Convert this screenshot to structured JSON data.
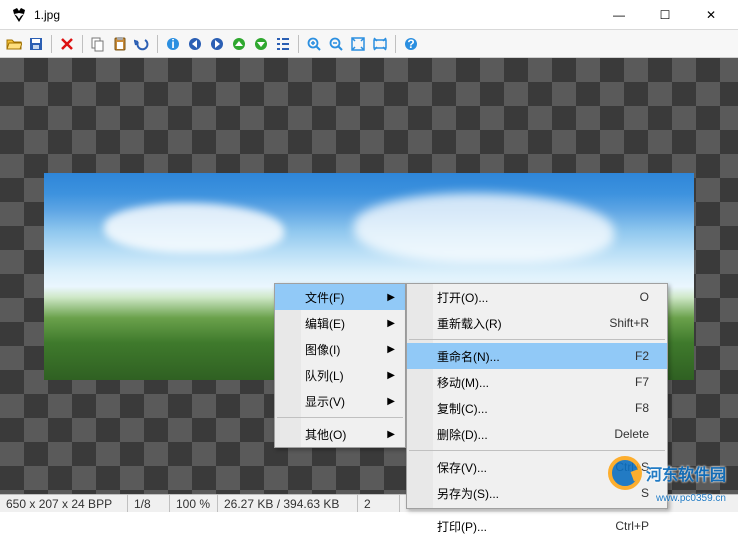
{
  "window": {
    "title": "1.jpg",
    "controls": {
      "min": "—",
      "max": "☐",
      "close": "✕"
    }
  },
  "toolbar": {
    "open": "open",
    "save": "save",
    "delete": "delete",
    "copy": "copy",
    "paste": "paste",
    "undo": "undo",
    "info": "info",
    "prev": "prev",
    "next": "next",
    "rotL": "rotate-left",
    "rotR": "rotate-right",
    "list": "list",
    "zoomIn": "zoom-in",
    "zoomOut": "zoom-out",
    "fit": "fit",
    "orig": "1:1",
    "help": "help"
  },
  "status": {
    "dims": "650 x 207 x 24 BPP",
    "page": "1/8",
    "zoom": "100 %",
    "size": "26.27 KB / 394.63 KB",
    "date": "2"
  },
  "menu": {
    "file": {
      "label": "文件(F)"
    },
    "edit": {
      "label": "编辑(E)"
    },
    "image": {
      "label": "图像(I)"
    },
    "queue": {
      "label": "队列(L)"
    },
    "view": {
      "label": "显示(V)"
    },
    "other": {
      "label": "其他(O)"
    }
  },
  "submenu": {
    "open": {
      "label": "打开(O)...",
      "shortcut": "O"
    },
    "reload": {
      "label": "重新载入(R)",
      "shortcut": "Shift+R"
    },
    "rename": {
      "label": "重命名(N)...",
      "shortcut": "F2"
    },
    "move": {
      "label": "移动(M)...",
      "shortcut": "F7"
    },
    "copy": {
      "label": "复制(C)...",
      "shortcut": "F8"
    },
    "delete": {
      "label": "删除(D)...",
      "shortcut": "Delete"
    },
    "save": {
      "label": "保存(V)...",
      "shortcut": "Ctrl+S"
    },
    "saveas": {
      "label": "另存为(S)...",
      "shortcut": "S"
    },
    "print": {
      "label": "打印(P)...",
      "shortcut": "Ctrl+P"
    }
  },
  "watermark": {
    "text": "河东软件园",
    "url": "www.pc0359.cn"
  }
}
